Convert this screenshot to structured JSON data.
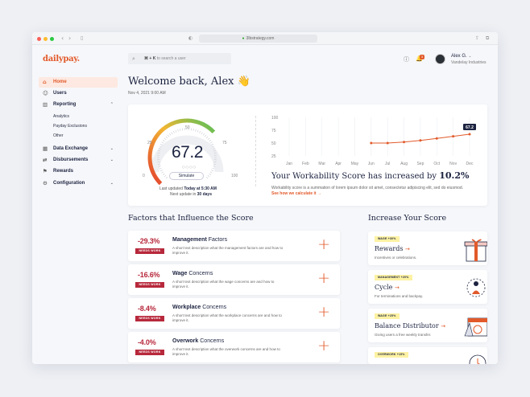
{
  "browser": {
    "url": "3lbstrategy.com"
  },
  "app": {
    "logo": "dailypay.",
    "search": {
      "shortcut": "⌘ + K",
      "placeholder": "to search a user"
    },
    "notifications_count": "3",
    "user": {
      "name": "Alex G.",
      "org": "Vandelay Industries"
    }
  },
  "sidebar": {
    "items": [
      {
        "label": "Home",
        "icon": "home-icon",
        "active": true
      },
      {
        "label": "Users",
        "icon": "users-icon"
      },
      {
        "label": "Reporting",
        "icon": "bar-chart-icon",
        "expanded": true
      },
      {
        "label": "Data Exchange",
        "icon": "calendar-icon"
      },
      {
        "label": "Disbursements",
        "icon": "transfer-icon"
      },
      {
        "label": "Rewards",
        "icon": "flag-icon"
      },
      {
        "label": "Configuration",
        "icon": "gear-icon"
      }
    ],
    "reporting_sub": [
      "Analytics",
      "Payday Exclusions",
      "Other"
    ]
  },
  "header": {
    "welcome": "Welcome back, Alex 👋",
    "date": "Nov 4, 2021 9:00 AM"
  },
  "gauge": {
    "score": "67.2",
    "value": 67.2,
    "tick_labels": [
      "0",
      "25",
      "50",
      "75",
      "100"
    ],
    "simulate_label": "Simulate",
    "last_updated_label": "Last updated",
    "last_updated_value": "Today at 5:30 AM",
    "next_update_label": "Next update in",
    "next_update_value": "30 days",
    "colors": {
      "low": "#e3402f",
      "mid": "#f2b632",
      "high": "#54c05a",
      "track": "#eeeff2"
    }
  },
  "chart_data": {
    "type": "line",
    "categories": [
      "Jan",
      "Feb",
      "Mar",
      "Apr",
      "May",
      "Jun",
      "Jul",
      "Aug",
      "Sep",
      "Oct",
      "Nov",
      "Dec"
    ],
    "series": [
      {
        "values": [
          null,
          null,
          null,
          null,
          null,
          50,
          50,
          52,
          55,
          59,
          63,
          67.2
        ]
      }
    ],
    "yticks": [
      "100",
      "75",
      "50",
      "25"
    ],
    "ylim": [
      25,
      100
    ],
    "callout": "67.2",
    "color": "#e25a2b",
    "grid": true
  },
  "workability": {
    "title_prefix": "Your Workability Score has increased by",
    "title_value": "10.2%",
    "description": "Workability score is a summation of lorem ipsum dolor sit amet, consectetur adipiscing elit, sed do eiusmod.",
    "link": "See how we calculate it →"
  },
  "factors_title": "Factors that Influence the Score",
  "factors": [
    {
      "pct": "-29.3%",
      "badge": "NEEDS WORK",
      "name_bold": "Management",
      "name_rest": " Factors",
      "desc": "A short text description what the management factors are and how to improve it."
    },
    {
      "pct": "-16.6%",
      "badge": "NEEDS WORK",
      "name_bold": "Wage",
      "name_rest": " Concerns",
      "desc": "A short text description what the wage concerns are and how to improve it."
    },
    {
      "pct": "-8.4%",
      "badge": "NEEDS WORK",
      "name_bold": "Workplace",
      "name_rest": " Concerns",
      "desc": "A short text description what the workplace concerns are and how to improve it."
    },
    {
      "pct": "-4.0%",
      "badge": "NEEDS WORK",
      "name_bold": "Overwork",
      "name_rest": " Concerns",
      "desc": "A short text description what the overwork concerns are and how to improve it."
    }
  ],
  "increase_title": "Increase Your Score",
  "increase": [
    {
      "tag": "WAGE +30%",
      "name": "Rewards",
      "arrow": "→",
      "desc": "Incentives or celebrations.",
      "illustration": "gift-icon"
    },
    {
      "tag": "MANAGEMENT +20%",
      "name": "Cycle",
      "arrow": "→",
      "desc": "For terminations and backpay.",
      "illustration": "cycle-icon"
    },
    {
      "tag": "WAGE +25%",
      "name": "Balance Distributor",
      "arrow": "→",
      "desc": "Giving users a free weekly transfer.",
      "illustration": "calendar-icon"
    },
    {
      "tag": "OVERWORK +15%",
      "name": "",
      "arrow": "",
      "desc": "",
      "illustration": "clock-icon"
    }
  ]
}
